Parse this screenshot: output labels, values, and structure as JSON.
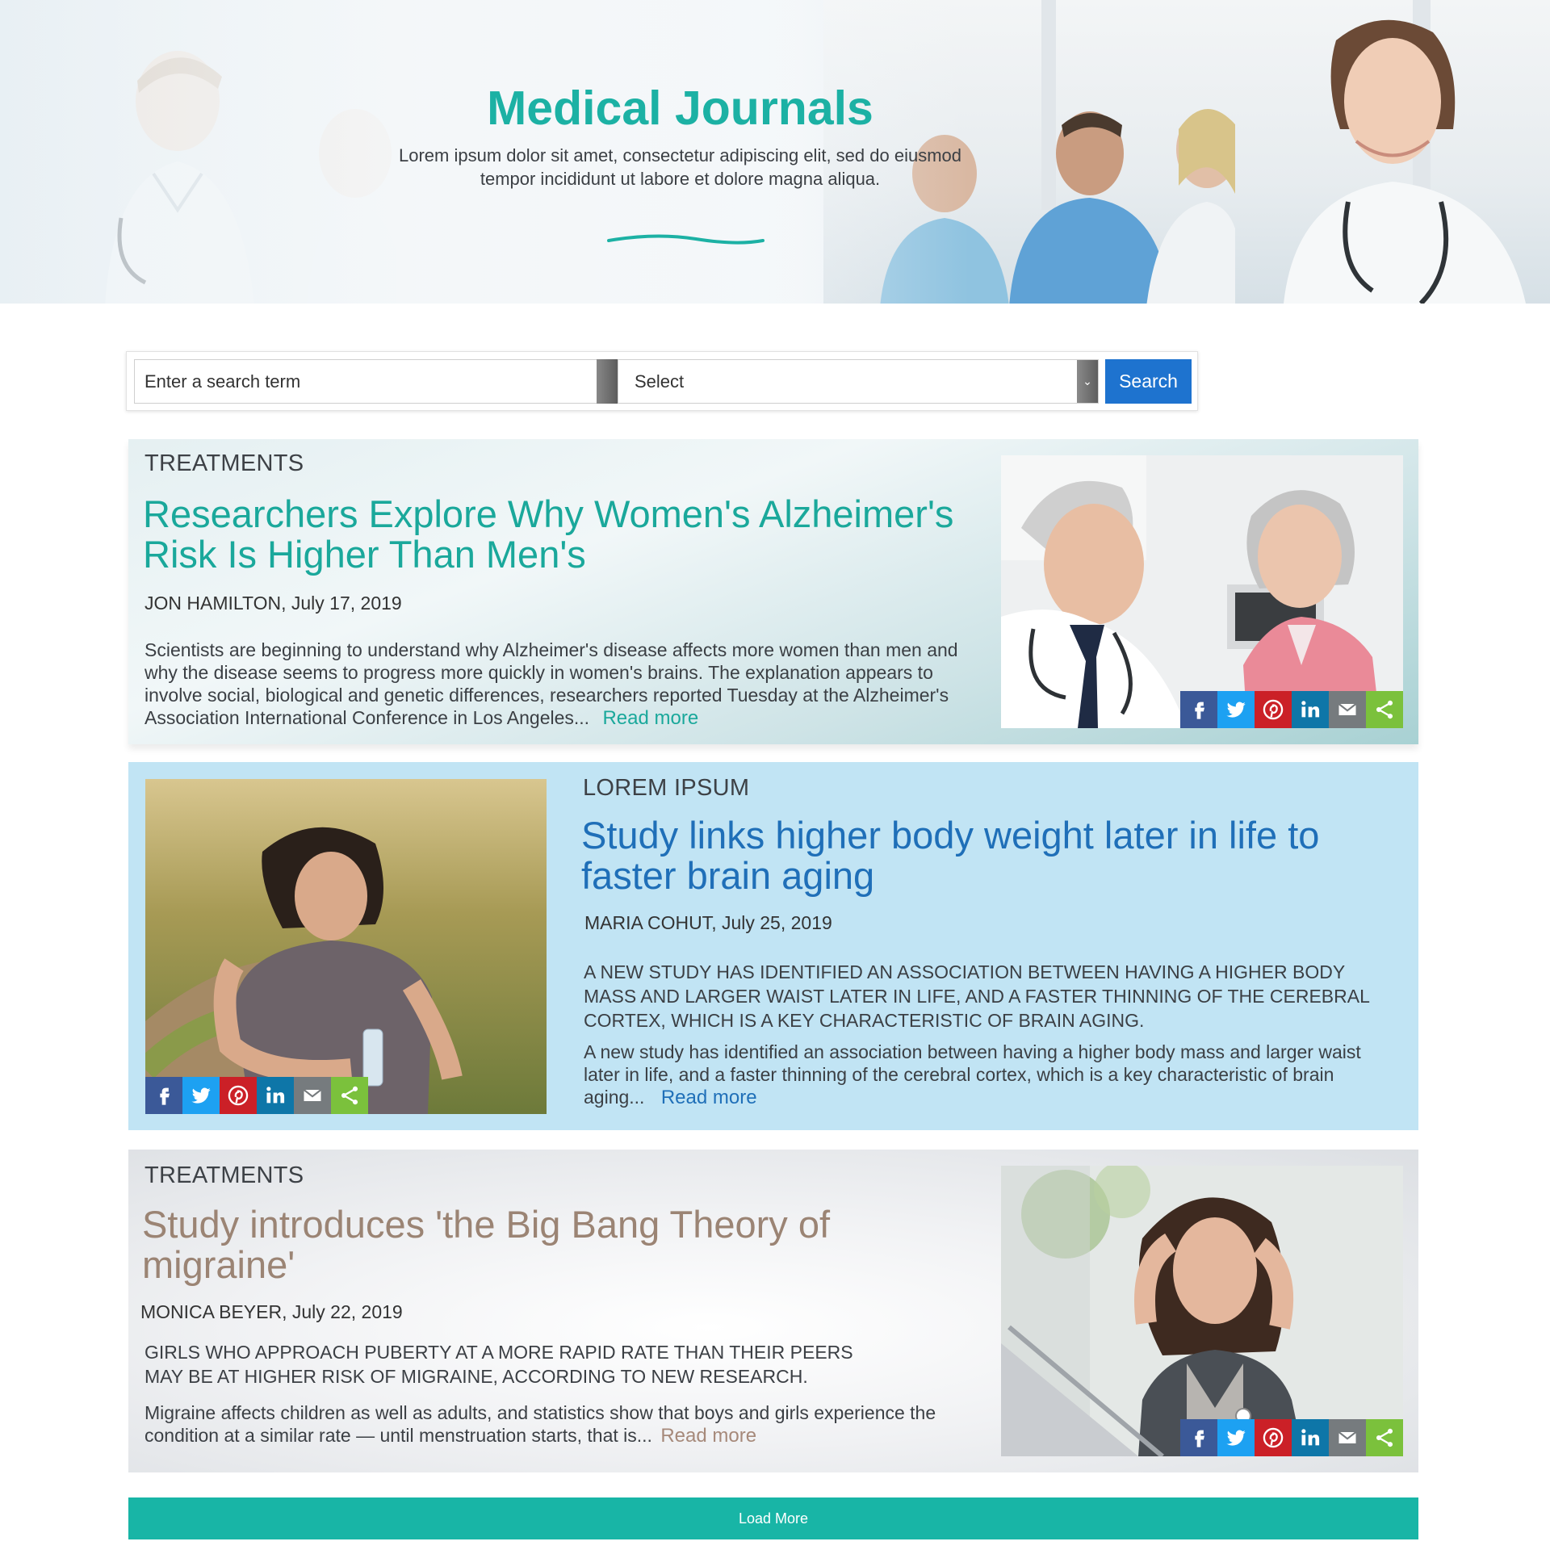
{
  "hero": {
    "title": "Medical Journals",
    "subtitle": "Lorem ipsum dolor sit amet, consectetur adipiscing elit, sed do eiusmod tempor incididunt ut labore et dolore magna aliqua.",
    "accent_color": "#1cb1a4"
  },
  "search": {
    "placeholder": "Enter a search term",
    "select_value": "Select",
    "button_label": "Search",
    "button_color": "#1e73cf"
  },
  "articles": [
    {
      "category": "TREATMENTS",
      "headline": "Researchers Explore Why Women's Alzheimer's Risk Is Higher Than Men's",
      "author": "JON HAMILTON",
      "date": "July 17, 2019",
      "summary": "",
      "body": "Scientists are beginning to understand why Alzheimer's disease affects more women than men and why the disease seems to progress more quickly in women's brains. The explanation appears to involve social, biological and genetic differences, researchers reported Tuesday at the Alzheimer's Association International Conference in Los Angeles...",
      "read_more": "Read more",
      "headline_color": "#1aa89b",
      "image": "doctor-with-senior-patient"
    },
    {
      "category": "LOREM IPSUM",
      "headline": "Study links higher body weight later in life to faster brain aging",
      "author": "MARIA COHUT",
      "date": "July 25, 2019",
      "summary": "A NEW STUDY HAS IDENTIFIED AN ASSOCIATION BETWEEN HAVING A HIGHER BODY MASS AND LARGER WAIST LATER IN LIFE, AND A FASTER THINNING OF THE CEREBRAL CORTEX, WHICH IS A KEY CHARACTERISTIC OF BRAIN AGING.",
      "body": "A new study has identified an association between having a higher body mass and larger waist later in life, and a faster thinning of the cerebral cortex, which is a key characteristic of brain aging...",
      "read_more": "Read more",
      "headline_color": "#1f6fb8",
      "image": "woman-in-field-with-water-bottle"
    },
    {
      "category": "TREATMENTS",
      "headline": "Study introduces 'the Big Bang Theory of migraine'",
      "author": "MONICA BEYER",
      "date": "July 22, 2019",
      "summary": "GIRLS WHO APPROACH PUBERTY AT A MORE RAPID RATE THAN THEIR PEERS MAY BE AT HIGHER RISK OF MIGRAINE, ACCORDING TO NEW RESEARCH.",
      "body": "Migraine affects children as well as adults, and statistics show that boys and girls experience the condition at a similar rate — until menstruation starts, that is...",
      "read_more": "Read more",
      "headline_color": "#9b8474",
      "image": "woman-with-headache-at-laptop"
    }
  ],
  "share_icons": [
    "facebook-icon",
    "twitter-icon",
    "pinterest-icon",
    "linkedin-icon",
    "email-icon",
    "share-icon"
  ],
  "share_colors": {
    "facebook": "#3b5998",
    "twitter": "#1da1f2",
    "pinterest": "#cb2027",
    "linkedin": "#0e76a8",
    "email": "#767b7e",
    "share": "#7bc13c"
  },
  "load_more": {
    "label": "Load More",
    "color": "#18b5a6"
  }
}
